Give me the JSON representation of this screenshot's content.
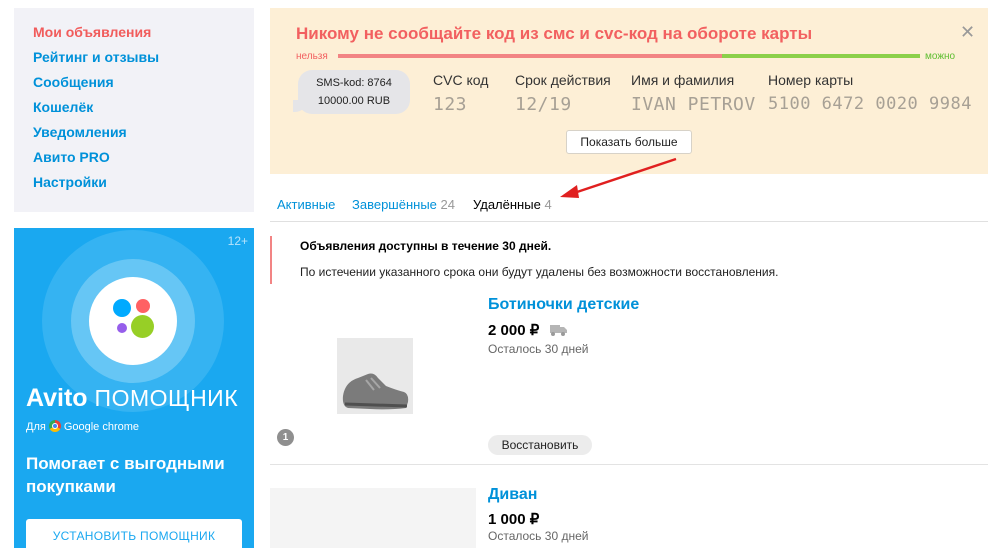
{
  "sidebar": {
    "items": [
      {
        "label": "Мои объявления",
        "active": true
      },
      {
        "label": "Рейтинг и отзывы",
        "active": false
      },
      {
        "label": "Сообщения",
        "active": false
      },
      {
        "label": "Кошелёк",
        "active": false
      },
      {
        "label": "Уведомления",
        "active": false
      },
      {
        "label": "Авито PRO",
        "active": false
      },
      {
        "label": "Настройки",
        "active": false
      }
    ]
  },
  "promo": {
    "age": "12+",
    "brand_bold": "Avito",
    "brand_rest": "ПОМОЩНИК",
    "for_prefix": "Для",
    "for_browser": "Google chrome",
    "tagline": "Помогает с выгодными покупками",
    "install_label": "УСТАНОВИТЬ ПОМОЩНИК"
  },
  "warning": {
    "title": "Никому не сообщайте код из смс и cvc-код на обороте карты",
    "close_icon": "close-icon",
    "scale_bad": "нельзя",
    "scale_good": "можно",
    "scale_bad_fraction": 0.66,
    "sms_line1": "SMS-kod: 8764",
    "sms_line2": "10000.00 RUB",
    "fields": [
      {
        "label": "CVC код",
        "value": "123"
      },
      {
        "label": "Срок действия",
        "value": "12/19"
      },
      {
        "label": "Имя и фамилия",
        "value": "IVAN PETROV"
      },
      {
        "label": "Номер карты",
        "value": "5100 6472 0020 9984"
      }
    ],
    "show_more": "Показать больше"
  },
  "tabs": [
    {
      "label": "Активные",
      "count": "",
      "active": false
    },
    {
      "label": "Завершённые",
      "count": "24",
      "active": false
    },
    {
      "label": "Удалённые",
      "count": "4",
      "active": true
    }
  ],
  "info": {
    "line1": "Объявления доступны в течение 30 дней.",
    "line2": "По истечении указанного срока они будут удалены без возможности восстановления."
  },
  "items": [
    {
      "title": "Ботиночки детские",
      "price": "2 000 ₽",
      "remaining": "Осталось 30 дней",
      "restore": "Восстановить",
      "photo_count": "1",
      "delivery_icon": "truck-icon"
    },
    {
      "title": "Диван",
      "price": "1 000 ₽",
      "remaining": "Осталось 30 дней"
    }
  ],
  "colors": {
    "link": "#0091d9",
    "accent_red": "#f15c5c",
    "warning_bg": "#fdefd6",
    "promo_bg": "#1aa8f0"
  }
}
